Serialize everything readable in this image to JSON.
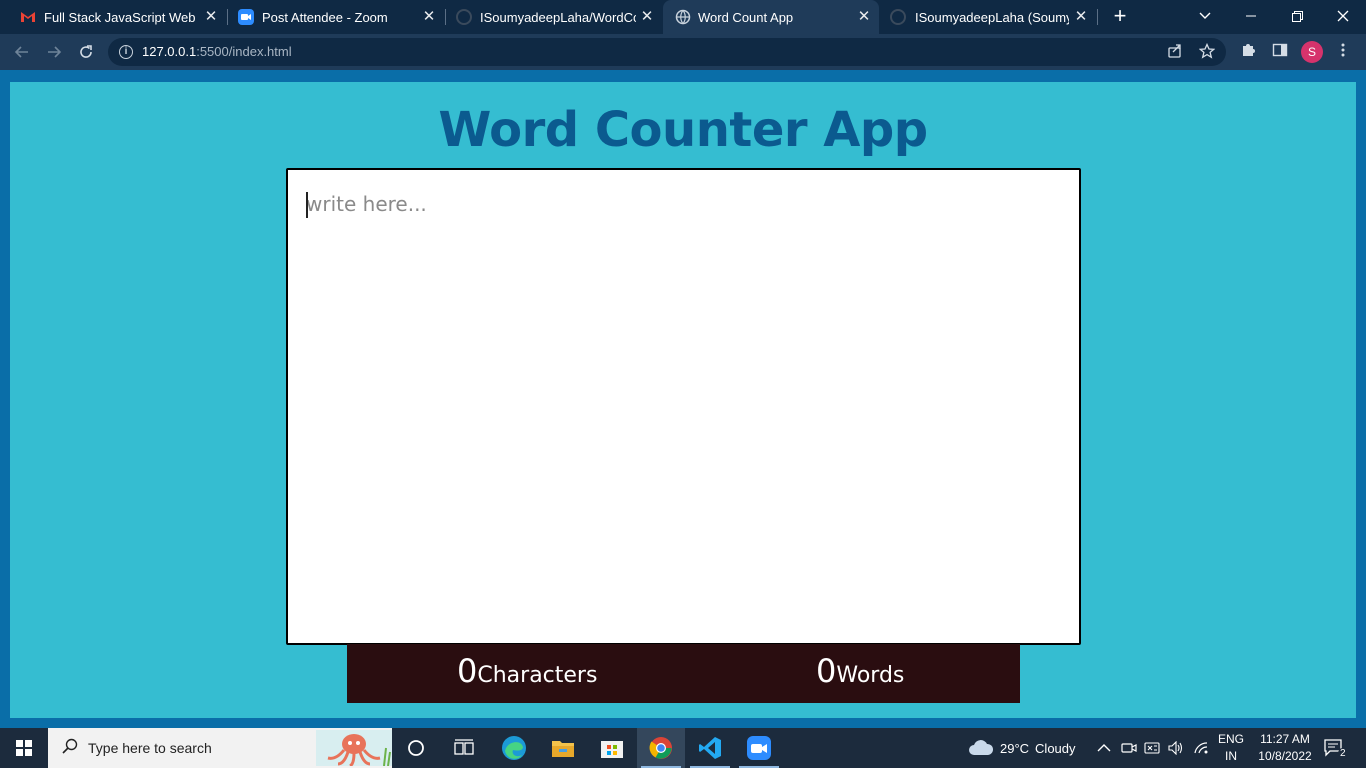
{
  "browser": {
    "tabs": [
      {
        "title": "Full Stack JavaScript Web De",
        "icon": "gmail-icon",
        "active": false
      },
      {
        "title": "Post Attendee - Zoom",
        "icon": "zoom-icon",
        "active": false
      },
      {
        "title": "ISoumyadeepLaha/WordCou",
        "icon": "github-icon",
        "active": false
      },
      {
        "title": "Word Count App",
        "icon": "globe-icon",
        "active": true
      },
      {
        "title": "ISoumyadeepLaha (Soumyad",
        "icon": "github-icon",
        "active": false
      }
    ],
    "close_glyph": "✕",
    "new_tab_glyph": "+",
    "url_host": "127.0.0.1",
    "url_rest": ":5500/index.html",
    "profile_initial": "S",
    "colors": {
      "tabstrip": "#0f2944",
      "toolbar": "#1f3b59",
      "profile": "#d6336c"
    }
  },
  "page": {
    "title": "Word Counter App",
    "textarea_placeholder": "write here...",
    "stats": {
      "characters_count": "0",
      "characters_label": "Characters",
      "words_count": "0",
      "words_label": "Words"
    },
    "colors": {
      "background": "#35bdd1",
      "frame": "#0a6ea8",
      "title": "#0b5a8f",
      "stats_bar": "#2a0d10"
    }
  },
  "taskbar": {
    "search_placeholder": "Type here to search",
    "apps": [
      "cortana-icon",
      "task-view-icon",
      "edge-icon",
      "file-explorer-icon",
      "microsoft-store-icon",
      "chrome-icon",
      "vscode-icon",
      "zoom-icon"
    ],
    "weather_temp": "29°C",
    "weather_desc": "Cloudy",
    "lang_line1": "ENG",
    "lang_line2": "IN",
    "time": "11:27 AM",
    "date": "10/8/2022",
    "notification_count": "2"
  }
}
